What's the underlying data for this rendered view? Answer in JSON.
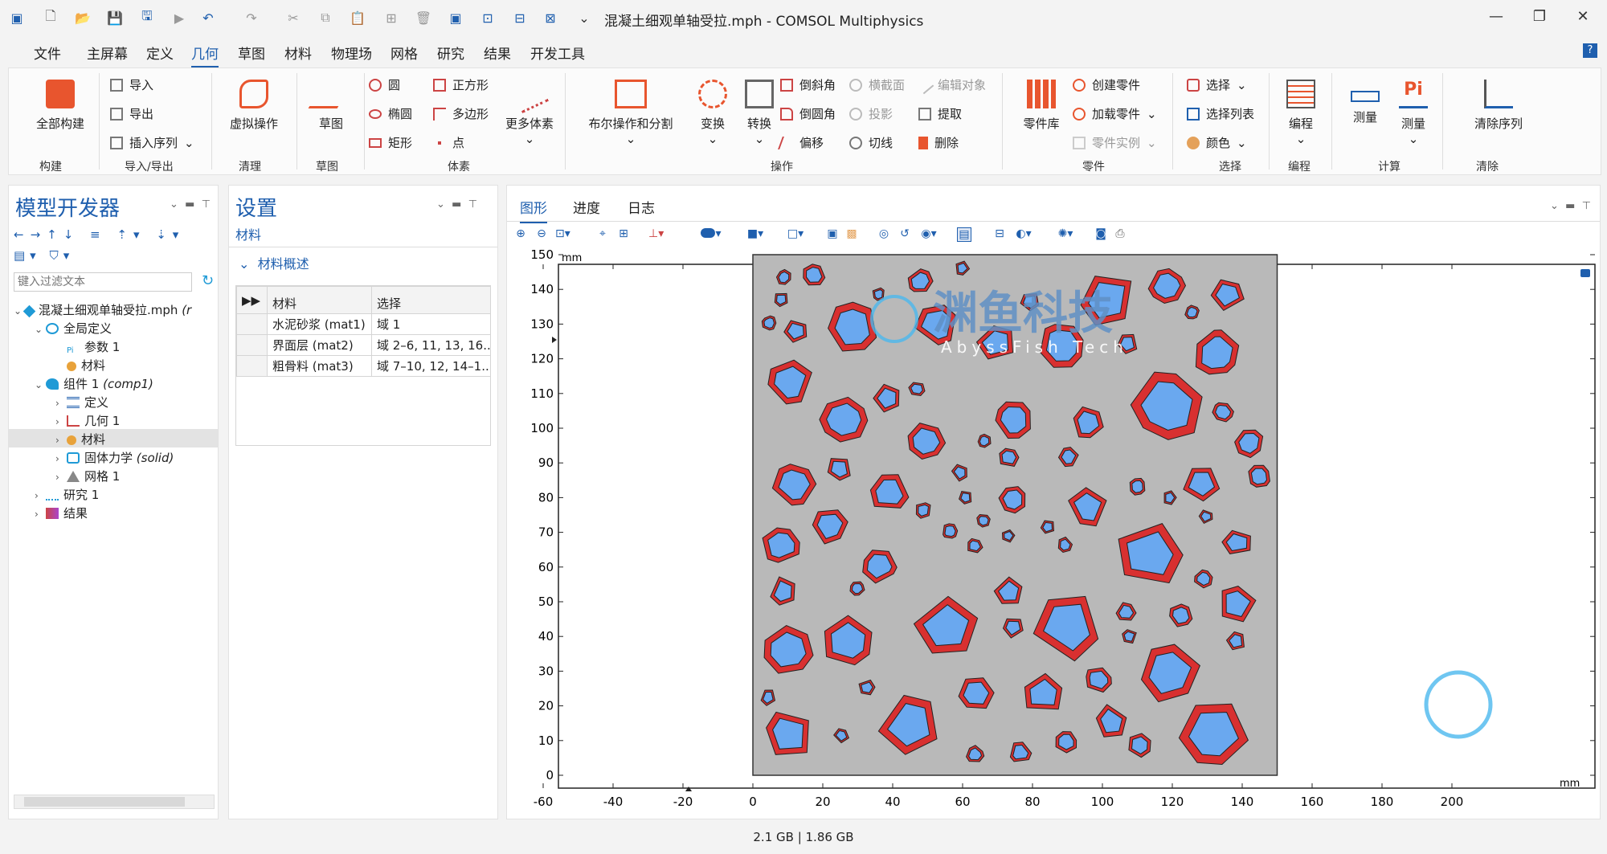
{
  "window": {
    "title": "混凝土细观单轴受拉.mph - COMSOL Multiphysics"
  },
  "menu": [
    "文件",
    "主屏幕",
    "定义",
    "几何",
    "草图",
    "材料",
    "物理场",
    "网格",
    "研究",
    "结果",
    "开发工具"
  ],
  "menu_active": "几何",
  "ribbon": {
    "build_all": "全部构建",
    "group_build": "构建",
    "import": "导入",
    "export": "导出",
    "insert_sequence": "插入序列",
    "group_io": "导入/导出",
    "virtual_ops": "虚拟操作",
    "group_cleanup": "清理",
    "sketch": "草图",
    "group_sketch": "草图",
    "circle": "圆",
    "ellipse": "椭圆",
    "rectangle": "矩形",
    "square": "正方形",
    "polygon": "多边形",
    "point": "点",
    "more_primitives": "更多体素",
    "group_primitives": "体素",
    "boolean_partition": "布尔操作和分割",
    "transforms": "变换",
    "conversions": "转换",
    "chamfer": "倒斜角",
    "fillet": "倒圆角",
    "offset": "偏移",
    "cross_section": "横截面",
    "projection": "投影",
    "tangent": "切线",
    "edit_object": "编辑对象",
    "extract": "提取",
    "delete": "删除",
    "group_operations": "操作",
    "part_library": "零件库",
    "create_part": "创建零件",
    "add_part": "加载零件",
    "part_instance": "零件实例",
    "group_parts": "零件",
    "selections": "选择",
    "selection_list": "选择列表",
    "colors": "颜色",
    "group_selections": "选择",
    "programming": "编程",
    "group_programming": "编程",
    "measure1": "测量",
    "measure2": "测量",
    "group_measurements": "计算",
    "clear_sequence": "清除序列",
    "group_clear": "清除"
  },
  "model_builder": {
    "title": "模型开发器",
    "filter_placeholder": "键入过滤文本",
    "root": "混凝土细观单轴受拉.mph",
    "root_suffix": "(r",
    "global_defs": "全局定义",
    "params": "参数 1",
    "materials_global": "材料",
    "component": "组件 1",
    "component_tag": "(comp1)",
    "definitions": "定义",
    "geometry": "几何 1",
    "materials": "材料",
    "solid": "固体力学",
    "solid_tag": "(solid)",
    "mesh": "网格 1",
    "study": "研究 1",
    "results": "结果"
  },
  "settings": {
    "title": "设置",
    "subtitle": "材料",
    "section": "材料概述",
    "col_material": "材料",
    "col_selection": "选择",
    "rows": [
      {
        "material": "水泥砂浆 (mat1)",
        "selection": "域 1"
      },
      {
        "material": "界面层 (mat2)",
        "selection": "域 2–6, 11, 13, 16..."
      },
      {
        "material": "粗骨料 (mat3)",
        "selection": "域 7–10, 12, 14–1..."
      }
    ]
  },
  "graphics": {
    "tabs": [
      "图形",
      "进度",
      "日志"
    ],
    "unit_top": "mm",
    "unit_right": "mm",
    "y_ticks": [
      "150",
      "140",
      "130",
      "120",
      "110",
      "100",
      "90",
      "80",
      "70",
      "60",
      "50",
      "40",
      "30",
      "20",
      "10",
      "0"
    ],
    "x_ticks": [
      "-60",
      "-40",
      "-20",
      "0",
      "20",
      "40",
      "60",
      "80",
      "100",
      "120",
      "140",
      "160",
      "180",
      "200"
    ],
    "watermark_cn": "渊鱼科技",
    "watermark_en": "AbyssFish Tech",
    "colors": {
      "matrix": "#b9b9b9",
      "interface": "#d83030",
      "aggregate": "#6aa8ef"
    }
  },
  "status": {
    "memory": "2.1 GB | 1.86 GB"
  }
}
